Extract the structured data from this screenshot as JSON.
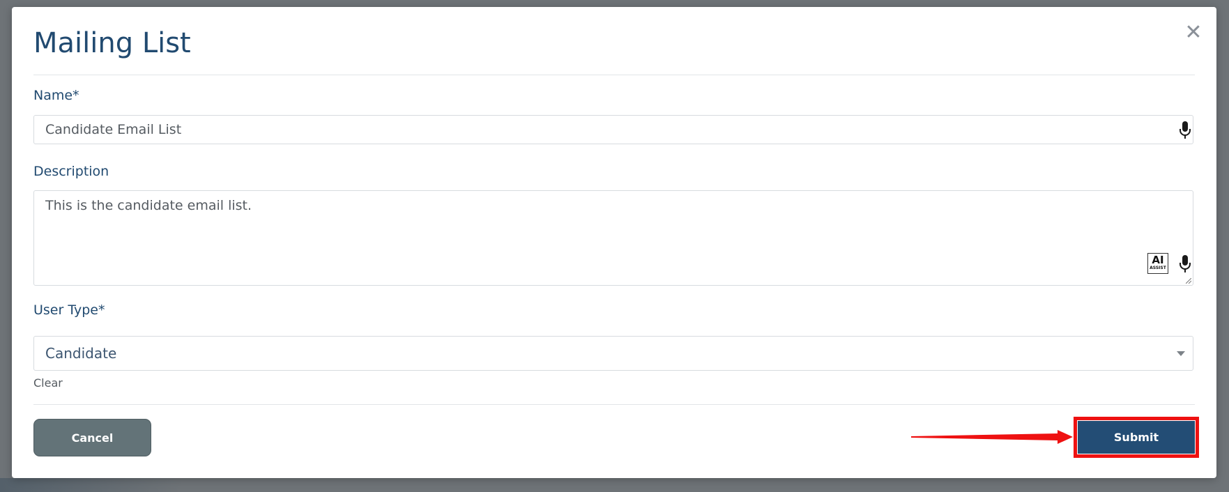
{
  "modal": {
    "title": "Mailing List",
    "close_glyph": "✕"
  },
  "form": {
    "name": {
      "label": "Name*",
      "value": "Candidate Email List"
    },
    "description": {
      "label": "Description",
      "value": "This is the candidate email list.",
      "ai_assist_big": "AI",
      "ai_assist_small": "ASSIST"
    },
    "user_type": {
      "label": "User Type*",
      "selected": "Candidate",
      "clear_label": "Clear"
    }
  },
  "footer": {
    "cancel_label": "Cancel",
    "submit_label": "Submit"
  },
  "colors": {
    "title": "#214a70",
    "cancel_button": "#637378",
    "submit_button": "#234d75",
    "highlight": "#ee1111"
  },
  "icons": [
    "close-icon",
    "microphone-icon",
    "ai-assist-icon",
    "chevron-down-icon",
    "arrow-annotation"
  ]
}
